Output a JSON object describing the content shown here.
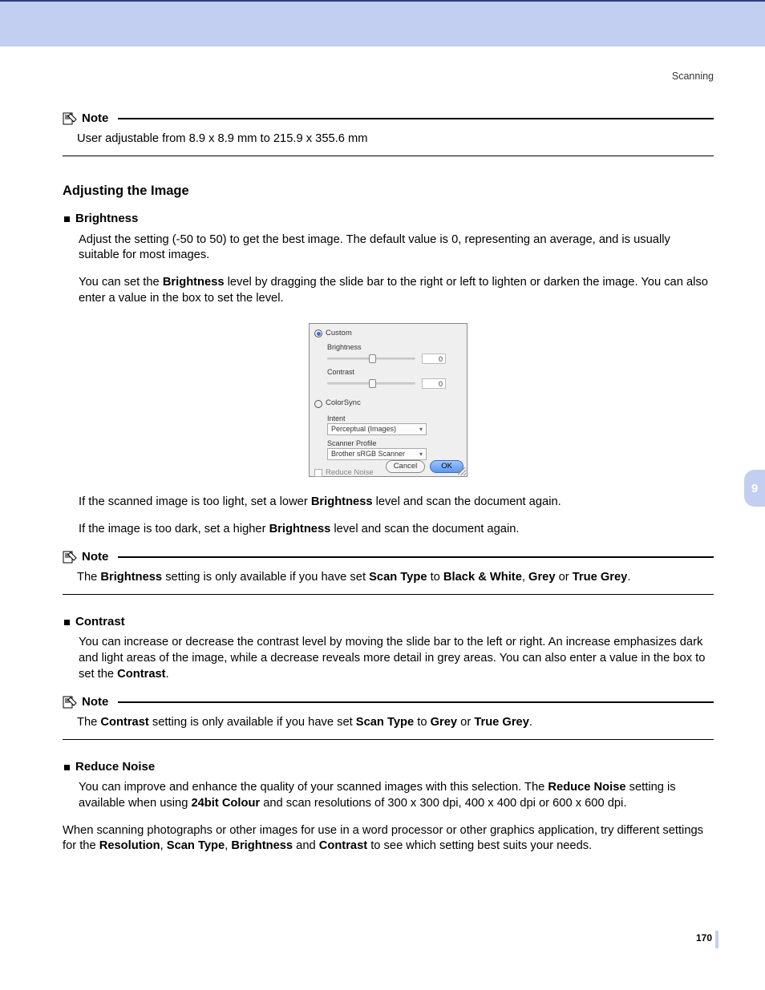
{
  "header": {
    "category": "Scanning"
  },
  "notes": {
    "label": "Note",
    "n1": "User adjustable from 8.9 x 8.9 mm to 215.9 x 355.6 mm",
    "n2_pre": "The ",
    "n2_b1": "Brightness",
    "n2_mid1": " setting is only available if you have set ",
    "n2_b2": "Scan Type",
    "n2_mid2": " to ",
    "n2_b3": "Black & White",
    "n2_mid3": ", ",
    "n2_b4": "Grey",
    "n2_mid4": " or ",
    "n2_b5": "True Grey",
    "n2_end": ".",
    "n3_pre": "The ",
    "n3_b1": "Contrast",
    "n3_mid1": " setting is only available if you have set ",
    "n3_b2": "Scan Type",
    "n3_mid2": " to ",
    "n3_b3": "Grey",
    "n3_mid3": " or ",
    "n3_b4": "True Grey",
    "n3_end": "."
  },
  "section": {
    "title": "Adjusting the Image"
  },
  "bullets": {
    "brightness": "Brightness",
    "contrast": "Contrast",
    "reduce": "Reduce Noise"
  },
  "paras": {
    "p1": "Adjust the setting (-50 to 50) to get the best image. The default value is 0, representing an average, and is usually suitable for most images.",
    "p2_pre": "You can set the ",
    "p2_b1": "Brightness",
    "p2_post": " level by dragging the slide bar to the right or left to lighten or darken the image. You can also enter a value in the box to set the level.",
    "p3_pre": "If the scanned image is too light, set a lower ",
    "p3_b1": "Brightness",
    "p3_post": " level and scan the document again.",
    "p4_pre": "If the image is too dark, set a higher ",
    "p4_b1": "Brightness",
    "p4_post": " level and scan the document again.",
    "p5_pre": "You can increase or decrease the contrast level by moving the slide bar to the left or right. An increase emphasizes dark and light areas of the image, while a decrease reveals more detail in grey areas. You can also enter a value in the box to set the ",
    "p5_b1": "Contrast",
    "p5_post": ".",
    "p6_pre": "You can improve and enhance the quality of your scanned images with this selection.  The ",
    "p6_b1": "Reduce Noise",
    "p6_mid": " setting is available when using ",
    "p6_b2": "24bit Colour",
    "p6_post": " and scan resolutions of 300 x 300 dpi, 400 x 400 dpi or 600 x 600 dpi.",
    "p7_pre": "When scanning photographs or other images for use in a word processor or other graphics application, try different settings for the ",
    "p7_b1": "Resolution",
    "p7_c1": ", ",
    "p7_b2": "Scan Type",
    "p7_c2": ", ",
    "p7_b3": "Brightness",
    "p7_c3": " and ",
    "p7_b4": "Contrast",
    "p7_post": " to see which setting best suits your needs."
  },
  "dialog": {
    "custom": "Custom",
    "brightness": "Brightness",
    "contrast": "Contrast",
    "brightness_val": "0",
    "contrast_val": "0",
    "colorsync": "ColorSync",
    "intent": "Intent",
    "intent_val": "Perceptual (Images)",
    "profile": "Scanner Profile",
    "profile_val": "Brother sRGB Scanner",
    "reduce": "Reduce Noise",
    "cancel": "Cancel",
    "ok": "OK"
  },
  "sidebar": {
    "chapter": "9"
  },
  "footer": {
    "page": "170"
  }
}
